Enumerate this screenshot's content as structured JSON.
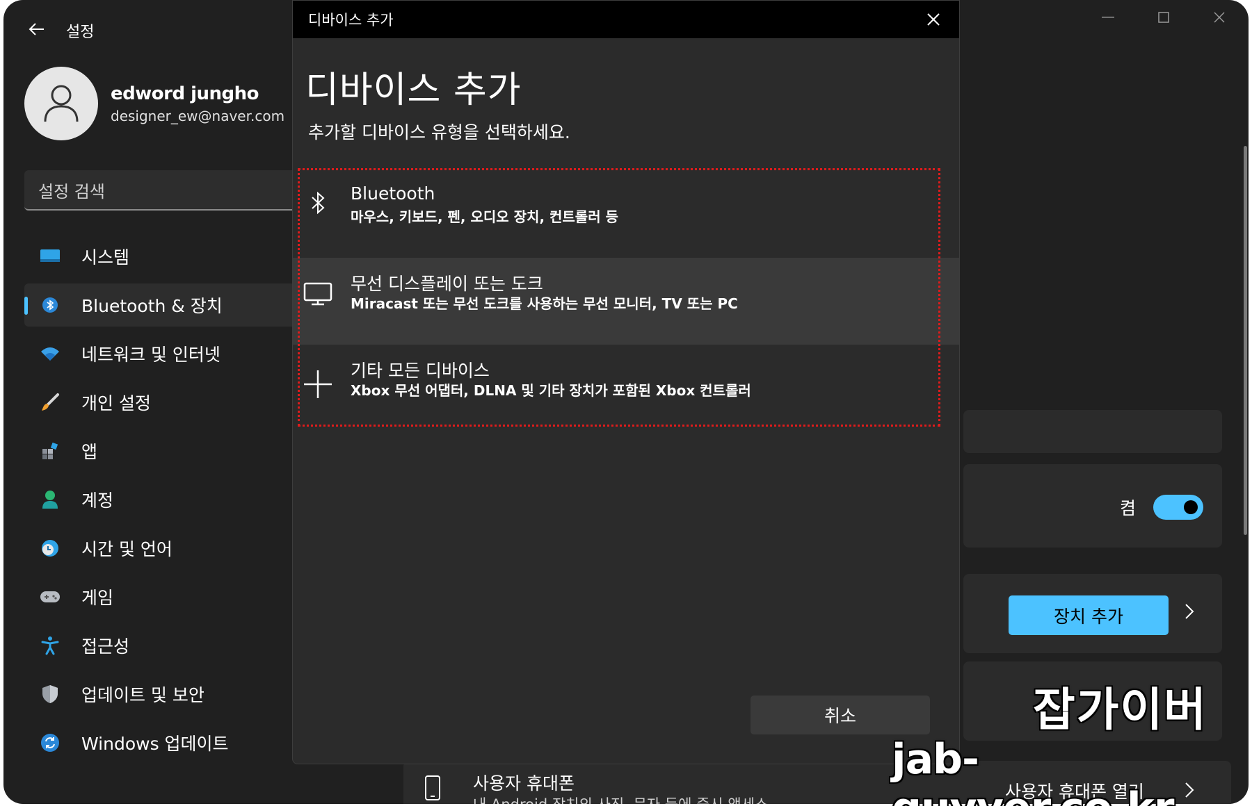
{
  "app": {
    "title": "설정"
  },
  "user": {
    "name": "edword jungho",
    "email": "designer_ew@naver.com"
  },
  "search": {
    "placeholder": "설정 검색"
  },
  "nav": {
    "items": [
      {
        "label": "시스템",
        "icon": "system-icon",
        "selected": false
      },
      {
        "label": "Bluetooth & 장치",
        "icon": "bluetooth-icon",
        "selected": true
      },
      {
        "label": "네트워크 및 인터넷",
        "icon": "wifi-icon",
        "selected": false
      },
      {
        "label": "개인 설정",
        "icon": "brush-icon",
        "selected": false
      },
      {
        "label": "앱",
        "icon": "apps-icon",
        "selected": false
      },
      {
        "label": "계정",
        "icon": "account-icon",
        "selected": false
      },
      {
        "label": "시간 및 언어",
        "icon": "clock-globe-icon",
        "selected": false
      },
      {
        "label": "게임",
        "icon": "gamepad-icon",
        "selected": false
      },
      {
        "label": "접근성",
        "icon": "accessibility-icon",
        "selected": false
      },
      {
        "label": "업데이트 및 보안",
        "icon": "shield-icon",
        "selected": false
      },
      {
        "label": "Windows 업데이트",
        "icon": "refresh-icon",
        "selected": false
      }
    ]
  },
  "background": {
    "toggle_label": "켬",
    "add_device_label": "장치 추가",
    "phone_title": "사용자 휴대폰",
    "phone_subtitle": "내 Android 장치의 사진, 문자 등에 즉시 액세스",
    "phone_open_label": "사용자 휴대폰 열기"
  },
  "dialog": {
    "titlebar": "디바이스 추가",
    "heading": "디바이스 추가",
    "prompt": "추가할 디바이스 유형을 선택하세요.",
    "options": [
      {
        "title": "Bluetooth",
        "description": "마우스, 키보드, 펜, 오디오 장치, 컨트롤러 등",
        "icon": "bluetooth-icon"
      },
      {
        "title": "무선 디스플레이 또는 도크",
        "description": "Miracast 또는 무선 도크를 사용하는 무선 모니터, TV 또는 PC",
        "icon": "monitor-icon"
      },
      {
        "title": "기타 모든 디바이스",
        "description": "Xbox 무선 어댑터, DLNA 및 기타 장치가 포함된 Xbox 컨트롤러",
        "icon": "plus-icon"
      }
    ],
    "cancel_label": "취소"
  },
  "watermark": {
    "line1": "잡가이버",
    "line2": "jab-guyver.co.kr"
  },
  "colors": {
    "accent": "#4cc2ff",
    "bg": "#202020",
    "card": "#2b2b2b",
    "highlight_border": "#e01b1b"
  }
}
